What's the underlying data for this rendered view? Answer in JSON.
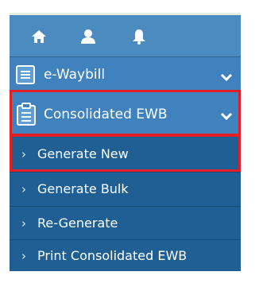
{
  "top_icons": [
    "home-icon",
    "user-icon",
    "bell-icon"
  ],
  "menu": {
    "ewaybill": {
      "label": "e-Waybill",
      "icon": "document-icon"
    },
    "consolidated": {
      "label": "Consolidated EWB",
      "icon": "clipboard-icon",
      "highlighted": true
    },
    "children": [
      {
        "label": "Generate New",
        "highlighted": true
      },
      {
        "label": "Generate Bulk"
      },
      {
        "label": "Re-Generate"
      },
      {
        "label": "Print Consolidated EWB"
      }
    ],
    "child_arrow": "›"
  },
  "colors": {
    "highlight": "#e31e24",
    "parent_bg": "#3f82bd",
    "child_bg": "#1f5f93",
    "top_bg": "#4b8bc0"
  }
}
